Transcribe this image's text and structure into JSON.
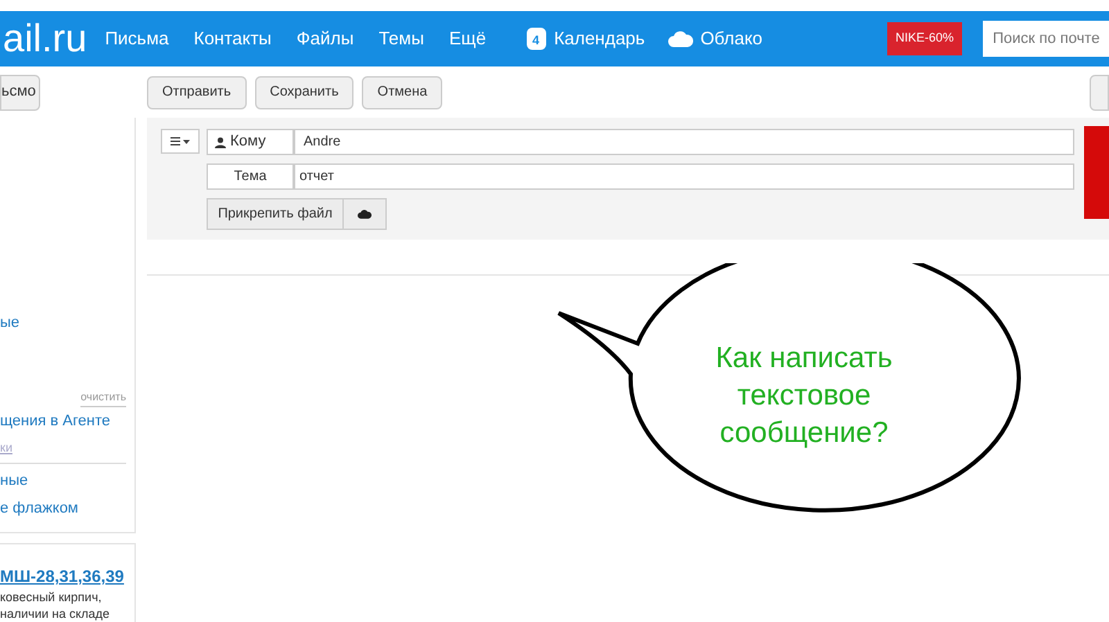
{
  "header": {
    "logo": "ail.ru",
    "nav": [
      {
        "label": "Письма"
      },
      {
        "label": "Контакты"
      },
      {
        "label": "Файлы"
      },
      {
        "label": "Темы"
      },
      {
        "label": "Ещё"
      }
    ],
    "calendar": {
      "label": "Календарь",
      "day": "4"
    },
    "cloud": {
      "label": "Облако"
    },
    "promo": "NIKE-60%",
    "search": {
      "placeholder": "Поиск по почте"
    }
  },
  "sidebar": {
    "compose_button": "ьсмо",
    "items": [
      {
        "kind": "link",
        "label": "ые"
      },
      {
        "kind": "action",
        "label": "очистить"
      },
      {
        "kind": "link",
        "label": "щения в Агенте"
      },
      {
        "kind": "faded",
        "label": "ки"
      },
      {
        "kind": "divider"
      },
      {
        "kind": "link",
        "label": "ные"
      },
      {
        "kind": "link",
        "label": "е флажком"
      }
    ],
    "ad": {
      "title": "МШ-28,31,36,39",
      "lines": [
        "ковесный кирпич,",
        "наличии на складе"
      ]
    }
  },
  "toolbar": {
    "buttons": [
      "Отправить",
      "Сохранить",
      "Отмена"
    ]
  },
  "compose": {
    "to": {
      "label": "Кому",
      "value": "Andre"
    },
    "subject": {
      "label": "Тема",
      "value": "отчет"
    },
    "attach_button": "Прикрепить файл"
  },
  "callout": {
    "text": "Как написать текстовое сообщение?"
  }
}
